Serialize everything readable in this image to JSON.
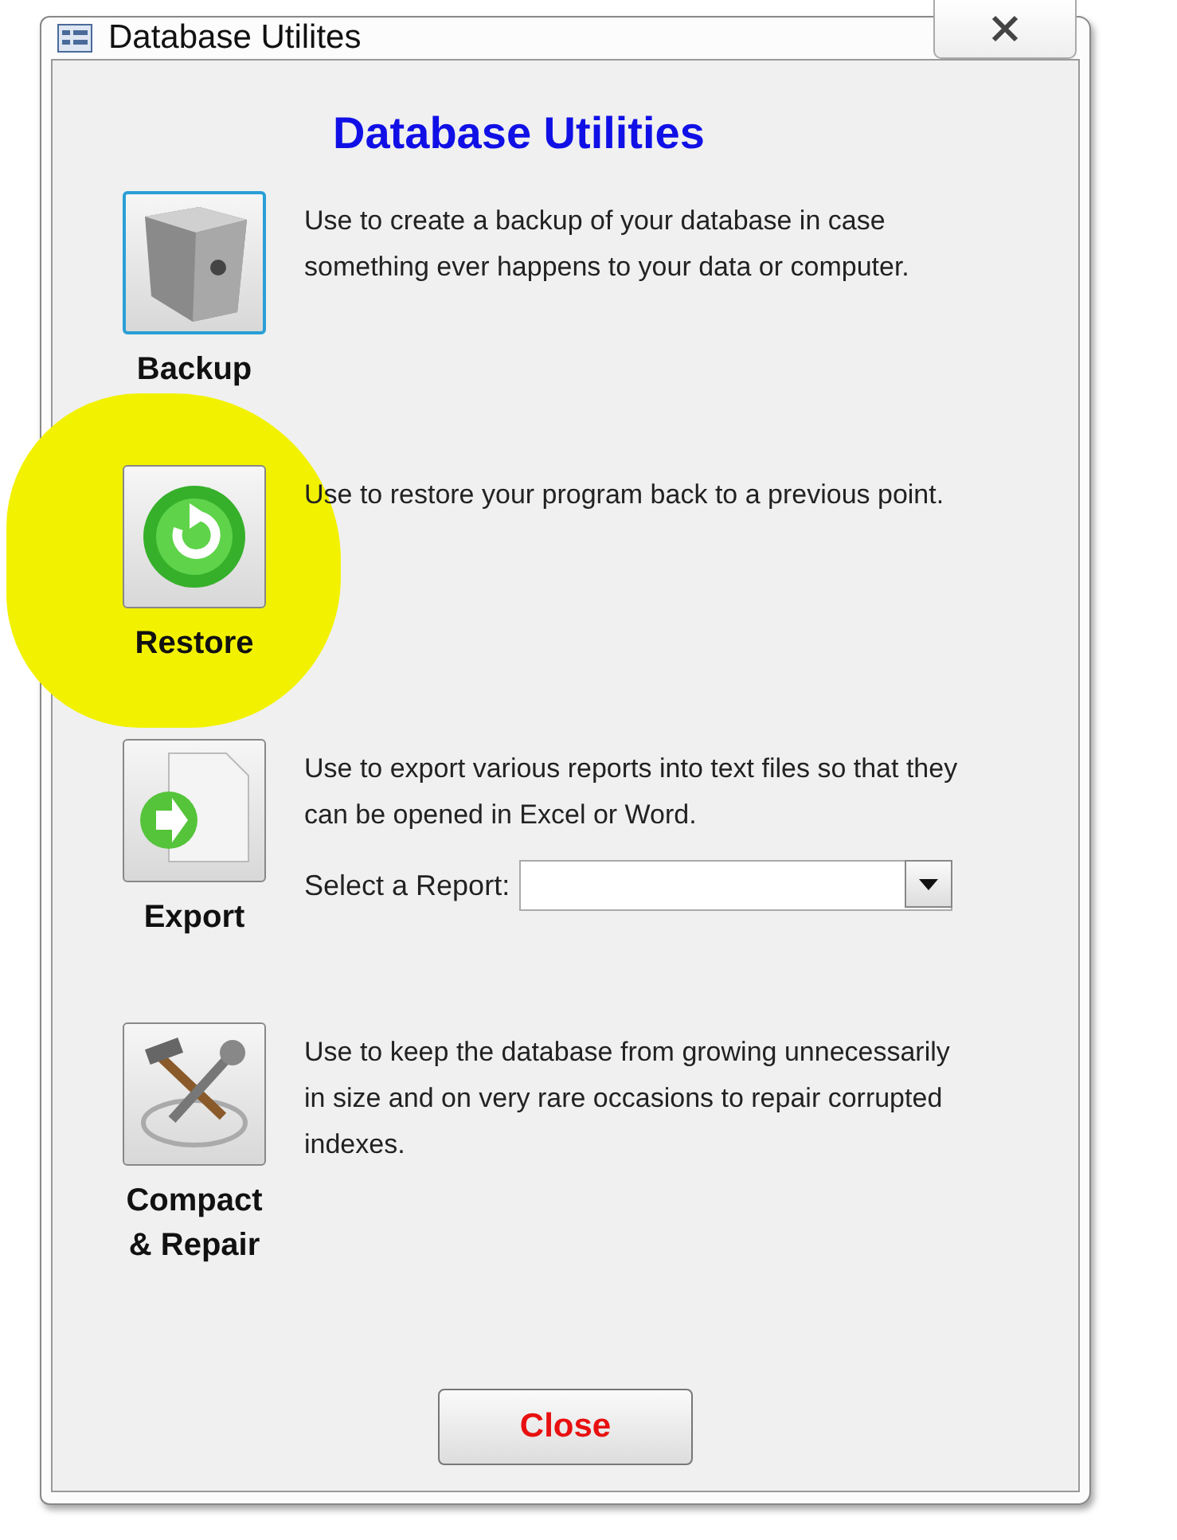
{
  "window": {
    "title": "Database Utilites"
  },
  "heading": "Database Utilities",
  "utilities": [
    {
      "kind": "safe",
      "label": "Backup",
      "description": "Use to create a backup of your database in case something ever happens to your data or computer.",
      "focused": true,
      "highlighted": false
    },
    {
      "kind": "restore",
      "label": "Restore",
      "description": "Use to restore your program back to a previous point.",
      "focused": false,
      "highlighted": true
    },
    {
      "kind": "export",
      "label": "Export",
      "description": "Use to export various reports into text files so that they can be opened in Excel or Word.",
      "select_label": "Select a Report:",
      "focused": false,
      "highlighted": false
    },
    {
      "kind": "tools",
      "label": "Compact & Repair",
      "description": "Use to keep the database from growing unnecessarily in size and on very rare occasions to repair corrupted indexes.",
      "focused": false,
      "highlighted": false
    }
  ],
  "close_button": "Close"
}
